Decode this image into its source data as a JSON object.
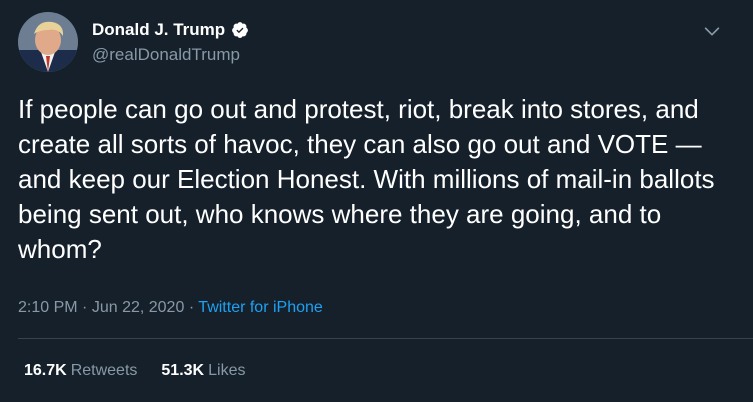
{
  "author": {
    "display_name": "Donald J. Trump",
    "handle": "@realDonaldTrump",
    "verified": true
  },
  "tweet": {
    "text": "If people can go out and protest, riot, break into stores, and create all sorts of havoc, they can also go out and VOTE — and keep our Election Honest. With millions of mail-in ballots being sent out, who knows where they are going, and to whom?",
    "time": "2:10 PM",
    "separator": "·",
    "date": "Jun 22, 2020",
    "source": "Twitter for iPhone"
  },
  "stats": {
    "retweets_count": "16.7K",
    "retweets_label": "Retweets",
    "likes_count": "51.3K",
    "likes_label": "Likes"
  },
  "icons": {
    "verified": "verified-badge-icon",
    "menu": "chevron-down-icon"
  },
  "colors": {
    "background": "#15202b",
    "primary_text": "#ffffff",
    "secondary_text": "#8899a6",
    "link": "#1da1f2",
    "divider": "#38444d"
  }
}
